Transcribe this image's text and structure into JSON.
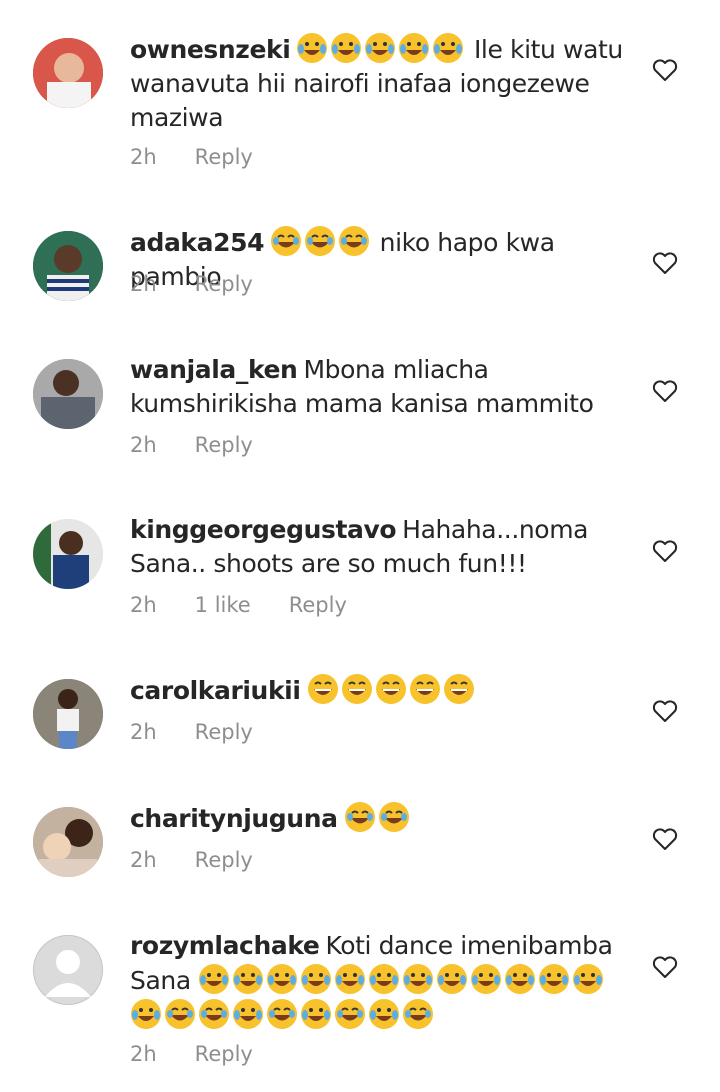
{
  "comments": [
    {
      "username": "ownesnzeki",
      "text": " Ile kitu watu wanavuta hii nairofi inafaa iongezewe maziwa",
      "emoji_lead": [
        "rofl-emoji",
        "rofl-emoji",
        "rofl-emoji",
        "rofl-emoji",
        "rofl-emoji"
      ],
      "time": "2h",
      "likes": "",
      "reply": "Reply",
      "avatar": "avatar-photo"
    },
    {
      "username": "adaka254",
      "text": " niko hapo kwa pambio",
      "emoji_lead": [
        "joy-emoji",
        "joy-emoji",
        "joy-emoji"
      ],
      "time": "2h",
      "likes": "",
      "reply": "Reply",
      "avatar": "avatar-photo"
    },
    {
      "username": "wanjala_ken",
      "text": "Mbona mliacha kumshirikisha mama kanisa mammito",
      "time": "2h",
      "likes": "",
      "reply": "Reply",
      "avatar": "avatar-photo"
    },
    {
      "username": "kinggeorgegustavo",
      "text": "Hahaha...noma Sana.. shoots are so much fun!!!",
      "time": "2h",
      "likes": "1 like",
      "reply": "Reply",
      "avatar": "avatar-photo"
    },
    {
      "username": "carolkariukii",
      "text": "",
      "emoji_lead": [
        "grin-emoji",
        "grin-emoji",
        "grin-emoji",
        "grin-emoji",
        "grin-emoji"
      ],
      "time": "2h",
      "likes": "",
      "reply": "Reply",
      "avatar": "avatar-photo"
    },
    {
      "username": "charitynjuguna",
      "text": "",
      "emoji_lead": [
        "joy-emoji",
        "joy-emoji"
      ],
      "time": "2h",
      "likes": "",
      "reply": "Reply",
      "avatar": "avatar-photo"
    },
    {
      "username": "rozymlachake",
      "text": "Koti  dance  imenibamba Sana",
      "emoji_tail": [
        "rofl-emoji",
        "rofl-emoji",
        "rofl-emoji",
        "rofl-emoji",
        "rofl-emoji",
        "rofl-emoji",
        "rofl-emoji",
        "rofl-emoji",
        "rofl-emoji",
        "rofl-emoji",
        "rofl-emoji",
        "rofl-emoji",
        "rofl-emoji",
        "joy-emoji",
        "joy-emoji",
        "rofl-emoji",
        "joy-emoji",
        "rofl-emoji",
        "joy-emoji",
        "rofl-emoji",
        "joy-emoji"
      ],
      "time": "2h",
      "likes": "",
      "reply": "Reply",
      "avatar": "avatar-placeholder"
    }
  ],
  "colors": {
    "text": "#262626",
    "meta": "#8e8e8e",
    "emoji": "#f8c22c"
  }
}
